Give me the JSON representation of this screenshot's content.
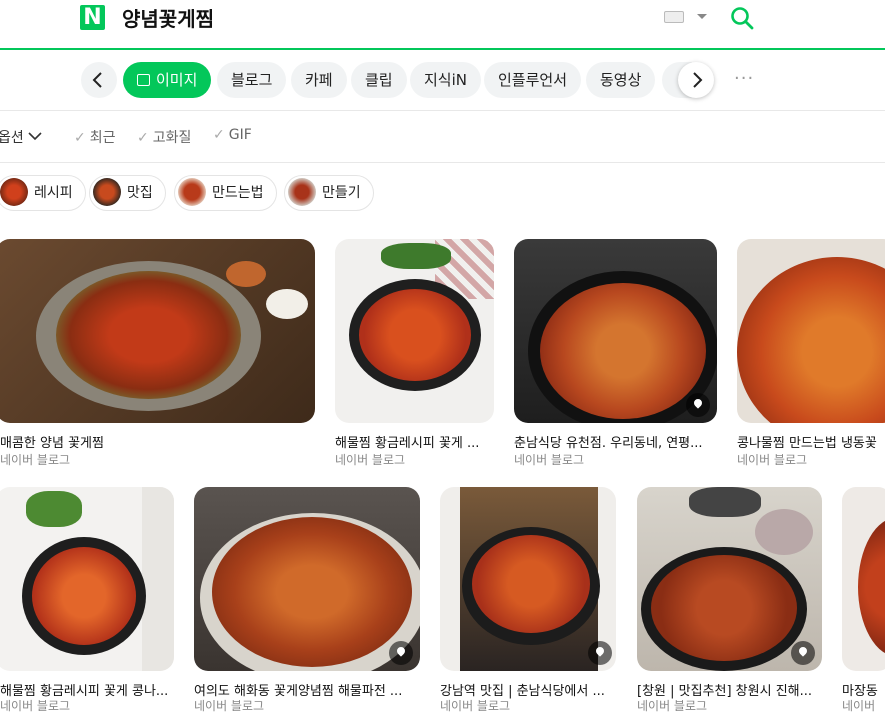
{
  "header": {
    "logo": "N",
    "query": "양념꽃게찜"
  },
  "tabs": [
    {
      "label": "이미지",
      "active": true
    },
    {
      "label": "블로그"
    },
    {
      "label": "카페"
    },
    {
      "label": "클립"
    },
    {
      "label": "지식iN"
    },
    {
      "label": "인플루언서"
    },
    {
      "label": "동영상"
    }
  ],
  "tab_more": "···",
  "options": {
    "main": "옵션",
    "filters": [
      "최근",
      "고화질",
      "GIF"
    ]
  },
  "chips": [
    {
      "label": "레시피"
    },
    {
      "label": "맛집"
    },
    {
      "label": "만드는법"
    },
    {
      "label": "만들기"
    }
  ],
  "results": [
    {
      "title": "매콤한 양념 꽃게찜",
      "source": "네이버 블로그"
    },
    {
      "title": "해물찜 황금레시피 꽃게 ...",
      "source": "네이버 블로그"
    },
    {
      "title": "춘남식당 유천점. 우리동네, 연평...",
      "source": "네이버 블로그"
    },
    {
      "title": "콩나물찜 만드는법 냉동꽃",
      "source": "네이버 블로그"
    },
    {
      "title": "해물찜 황금레시피 꽃게 콩나...",
      "source": "네이버 블로그"
    },
    {
      "title": "여의도 해화동 꽃게양념찜 해물파전 ...",
      "source": "네이버 블로그"
    },
    {
      "title": "강남역 맛집 | 춘남식당에서 ...",
      "source": "네이버 블로그"
    },
    {
      "title": "[창원 | 맛집추천] 창원시 진해...",
      "source": "네이버 블로그"
    },
    {
      "title": "마장동",
      "source": "네이버"
    }
  ],
  "colors": {
    "brand": "#03c75a",
    "sauce": "#b8361a",
    "bowl": "#2a2a2a"
  }
}
